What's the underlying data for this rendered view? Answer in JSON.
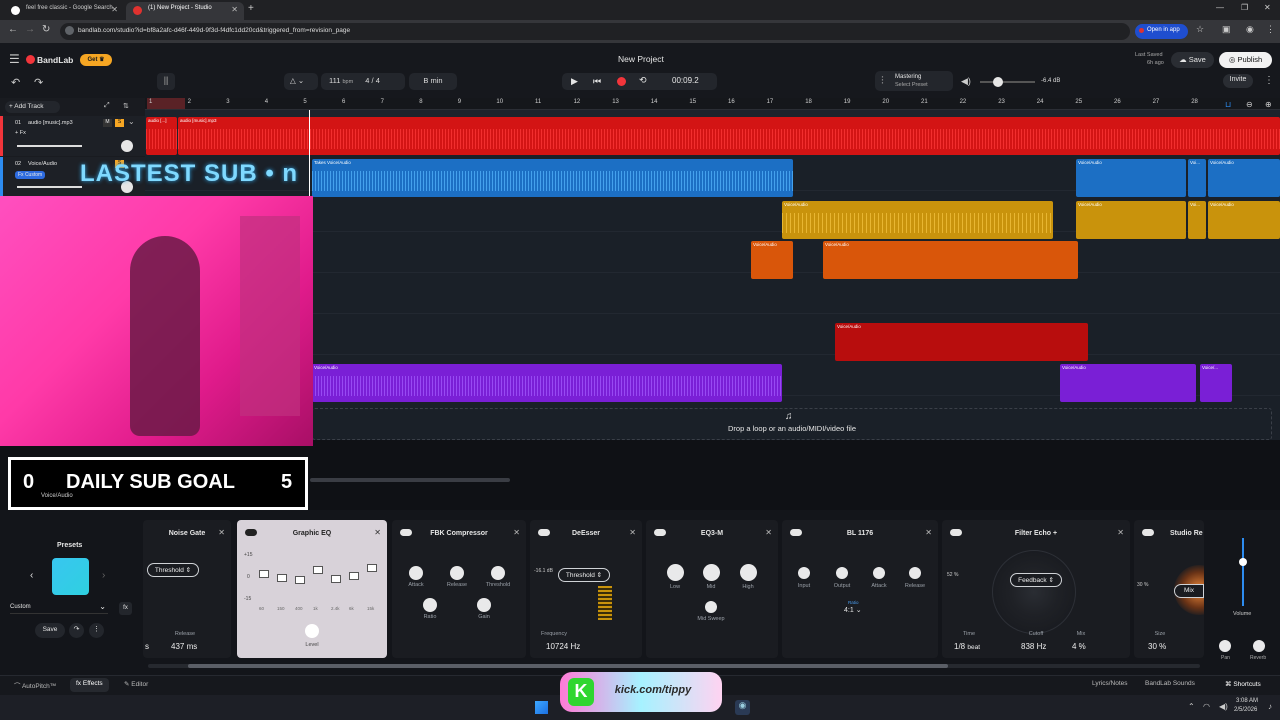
{
  "browser": {
    "tabs": [
      {
        "label": "feel free classic - Google Search",
        "active": false
      },
      {
        "label": "(1) New Project - Studio",
        "active": true
      }
    ],
    "url": "bandlab.com/studio?id=bf8a2afc-d46f-449d-9f3d-f4dfc1dd20cd&triggered_from=revision_page",
    "open_in_app": "Open in app"
  },
  "app": {
    "brand": "BandLab",
    "get_label": "Get",
    "project_title": "New Project",
    "last_saved_label": "Last Saved",
    "last_saved_time": "6h ago",
    "save_label": "Save",
    "publish_label": "Publish",
    "invite_label": "Invite",
    "bpm": "111",
    "bpm_unit": "bpm",
    "time_signature": "4 / 4",
    "key": "B min",
    "time": "00:09.2",
    "mastering_label": "Mastering",
    "mastering_preset": "Select Preset",
    "master_db": "-6.4 dB",
    "accent": "#f2353b"
  },
  "tracks": {
    "add_track": "Add Track",
    "items": [
      {
        "number": "01",
        "name": "audio [music].mp3",
        "fx": "+ Fx"
      },
      {
        "number": "02",
        "name": "Voice/Audio",
        "fx": "Fx Custom"
      }
    ]
  },
  "ruler": [
    "1",
    "2",
    "3",
    "4",
    "5",
    "6",
    "7",
    "8",
    "9",
    "10",
    "11",
    "12",
    "13",
    "14",
    "15",
    "16",
    "17",
    "18",
    "19",
    "20",
    "21",
    "22",
    "23",
    "24",
    "25",
    "26",
    "27",
    "28"
  ],
  "clips": {
    "music_a": "audio [...]",
    "music_b": "audio [music].mp3",
    "voice": "Voice/Audio",
    "voice_short": "Voi...",
    "voice_trunc": "Voice/...",
    "takes": "Takes"
  },
  "dropzone": "Drop a loop or an audio/MIDI/video file",
  "overlay": {
    "latest_sub": "LASTEST SUB • n",
    "goal_current": "0",
    "goal_label": "DAILY SUB GOAL",
    "goal_target": "5",
    "goal_track": "Voice/Audio"
  },
  "presets": {
    "title": "Presets",
    "current": "Custom",
    "save": "Save"
  },
  "effects": [
    {
      "title": "Noise Gate",
      "param": "Threshold",
      "value_label": "Release",
      "value": "437 ms",
      "prefix": "s"
    },
    {
      "title": "Graphic EQ",
      "db_top": "+15",
      "db_mid": "0",
      "db_bot": "-15",
      "bands": [
        "60",
        "150",
        "400",
        "1k",
        "2.4k",
        "6k",
        "15k"
      ],
      "level": "Level"
    },
    {
      "title": "FBK Compressor",
      "knobs": [
        "Attack",
        "Release",
        "Threshold"
      ],
      "knobs2": [
        "Ratio",
        "Gain"
      ]
    },
    {
      "title": "DeEsser",
      "param": "Threshold",
      "db": "-16.1 dB",
      "value_label": "Frequency",
      "value": "10724 Hz"
    },
    {
      "title": "EQ3-M",
      "knobs": [
        "Low",
        "Mid",
        "High"
      ],
      "knobs2": [
        "Mid Sweep"
      ]
    },
    {
      "title": "BL 1176",
      "knobs": [
        "Input",
        "Output",
        "Attack",
        "Release"
      ],
      "ratio_label": "Ratio",
      "ratio": "4:1"
    },
    {
      "title": "Filter Echo +",
      "param": "Feedback",
      "pct": "52 %",
      "time_label": "Time",
      "time": "1/8",
      "time_unit": "beat",
      "cutoff_label": "Cutoff",
      "cutoff": "838 Hz",
      "mix_label": "Mix",
      "mix": "4 %"
    },
    {
      "title": "Studio Re",
      "pct": "30 %",
      "param": "Mix",
      "size_label": "Size",
      "size": "30 %"
    }
  ],
  "master": {
    "volume": "Volume",
    "pan": "Pan",
    "reverb": "Reverb"
  },
  "bottom_tabs": [
    "AutoPitch™",
    "Effects",
    "Editor",
    "Lyrics/Notes",
    "BandLab Sounds",
    "Shortcuts"
  ],
  "kick": "kick.com/tippy",
  "clock": {
    "time": "3:08 AM",
    "date": "2/5/2026"
  }
}
